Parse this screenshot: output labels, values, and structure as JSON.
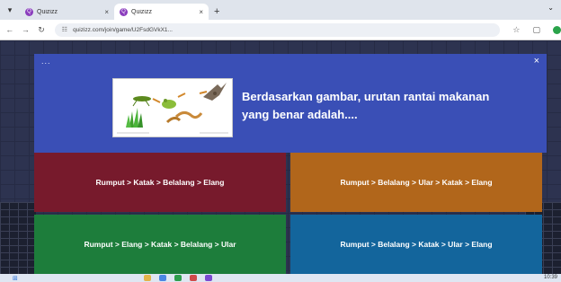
{
  "browser": {
    "tabs": [
      {
        "title": "Quizizz",
        "active": false
      },
      {
        "title": "Quizizz",
        "active": true
      }
    ],
    "favicon_glyph": "Q",
    "new_tab_label": "+",
    "address": "quizizz.com/join/game/U2FsdGVkX1...",
    "icons": [
      "back-icon",
      "forward-icon",
      "reload-icon",
      "site-info-icon",
      "star-icon",
      "extensions-icon",
      "profile-icon"
    ]
  },
  "quiz": {
    "menu_label": "...",
    "close_label": "×",
    "question": "Berdasarkan gambar, urutan rantai makanan yang benar adalah....",
    "answers": [
      {
        "text": "Rumput > Katak > Belalang > Elang",
        "color": "#771a2c"
      },
      {
        "text": "Rumput > Belalang > Ular > Katak > Elang",
        "color": "#b1661b"
      },
      {
        "text": "Rumput > Elang > Katak > Belalang > Ular",
        "color": "#1d7d3b"
      },
      {
        "text": "Rumput > Belalang > Katak > Ular > Elang",
        "color": "#13659c"
      }
    ],
    "header_color": "#3a4fb6"
  },
  "taskbar": {
    "tray_time": "10:39"
  }
}
